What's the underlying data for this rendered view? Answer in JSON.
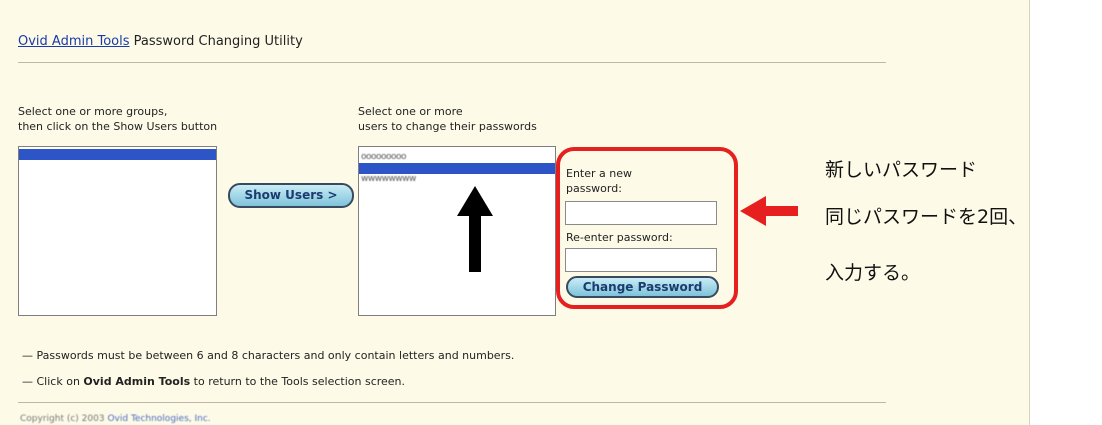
{
  "header": {
    "admin_link": "Ovid Admin Tools",
    "title_rest": "Password Changing Utility"
  },
  "groups": {
    "instruction_line1": "Select one or more groups,",
    "instruction_line2": "then click on the Show Users button",
    "options": [
      ""
    ]
  },
  "show_users_button": "Show Users >",
  "users": {
    "instruction_line1": "Select one or more",
    "instruction_line2": "users to change their passwords",
    "options": [
      "ooooooooo",
      "",
      "wwwwwwww"
    ]
  },
  "password_form": {
    "new_label_line1": "Enter a new",
    "new_label_line2": "password:",
    "reenter_label": "Re-enter password:",
    "change_button": "Change Password"
  },
  "notes": {
    "dash": "—",
    "note1": "Passwords must be between 6 and 8 characters and only contain letters and numbers.",
    "note2_pre": "Click on ",
    "note2_bold": "Ovid Admin Tools",
    "note2_post": " to return to the Tools selection screen."
  },
  "footer": {
    "copyright_text": "Copyright (c) 2003",
    "company_link": "Ovid Technologies, Inc."
  },
  "annotation": {
    "line1": "新しいパスワード",
    "line2": "同じパスワードを2回、",
    "line3": "入力する。"
  },
  "colors": {
    "panel_bg": "#fdfbe8",
    "selection": "#2d55c8",
    "callout_red": "#e61f1f",
    "link": "#1a3aa8"
  }
}
